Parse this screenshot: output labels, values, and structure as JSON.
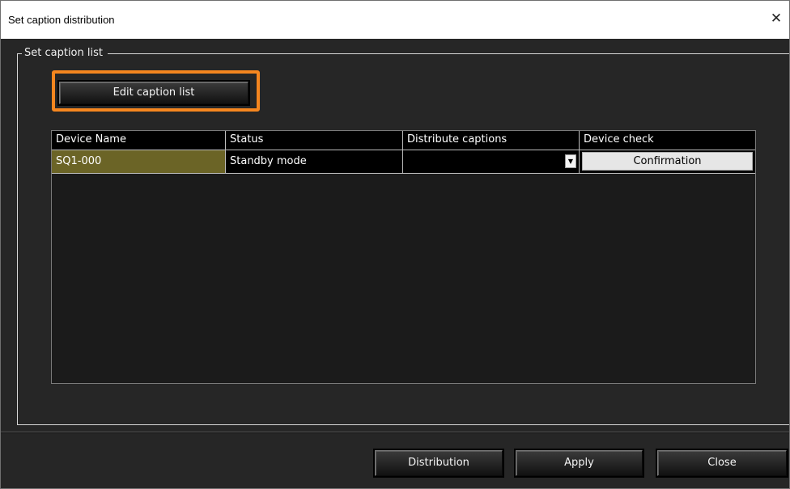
{
  "window": {
    "title": "Set caption distribution",
    "close_glyph": "✕"
  },
  "group": {
    "label": "Set caption list"
  },
  "toolbar": {
    "edit_caption_list_label": "Edit caption list",
    "highlight_color": "#f5861f"
  },
  "table": {
    "headers": [
      "Device Name",
      "Status",
      "Distribute captions",
      "Device check"
    ],
    "rows": [
      {
        "device_name": "SQ1-000",
        "status": "Standby mode",
        "distribute": "",
        "device_check_label": "Confirmation"
      }
    ]
  },
  "footer": {
    "distribution_label": "Distribution",
    "apply_label": "Apply",
    "close_label": "Close"
  },
  "colors": {
    "background": "#262626",
    "selected_cell": "#6b6426"
  },
  "icons": {
    "dropdown": "chevron-down-icon",
    "close": "close-icon"
  }
}
